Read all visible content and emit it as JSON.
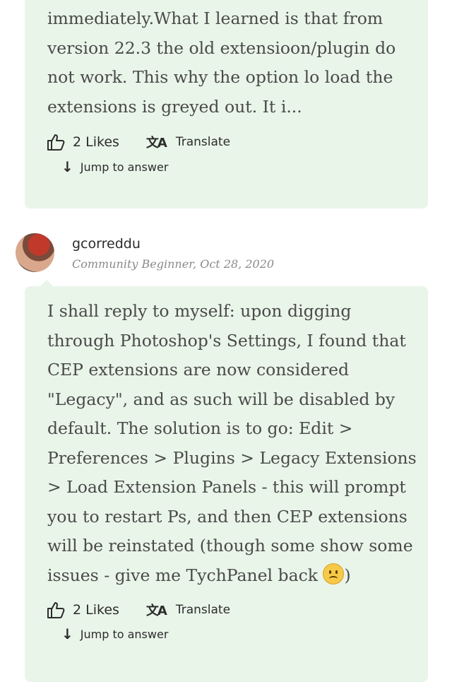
{
  "post1": {
    "body": "immediately.What I learned is that from version 22.3 the old extensioon/plugin do not work. This why the option lo load the extensions is greyed out. It i...",
    "likes_label": "2 Likes",
    "translate_label": "Translate",
    "jump_label": "Jump to answer"
  },
  "post2": {
    "author": "gcorreddu",
    "meta": "Community Beginner, Oct 28, 2020",
    "body_before_emoji": "I shall reply to myself: upon digging through Photoshop's Settings, I found that CEP extensions are now considered \"Legacy\", and as such will be disabled by default. The solution is to go: Edit > Preferences > Plugins > Legacy Extensions > Load Extension Panels - this will prompt you to restart Ps, and then CEP extensions will be reinstated (though some show some issues - give me TychPanel back ",
    "body_after_emoji": ")",
    "likes_label": "2 Likes",
    "translate_label": "Translate",
    "jump_label": "Jump to answer"
  },
  "icons": {
    "like": "thumbs-up-icon",
    "translate": "translate-icon",
    "jump": "arrow-down-icon",
    "emoji": "frowning-face-emoji"
  },
  "colors": {
    "card_bg": "#e9f5e9",
    "text": "#4a4a4a",
    "meta": "#8a8a8a"
  }
}
